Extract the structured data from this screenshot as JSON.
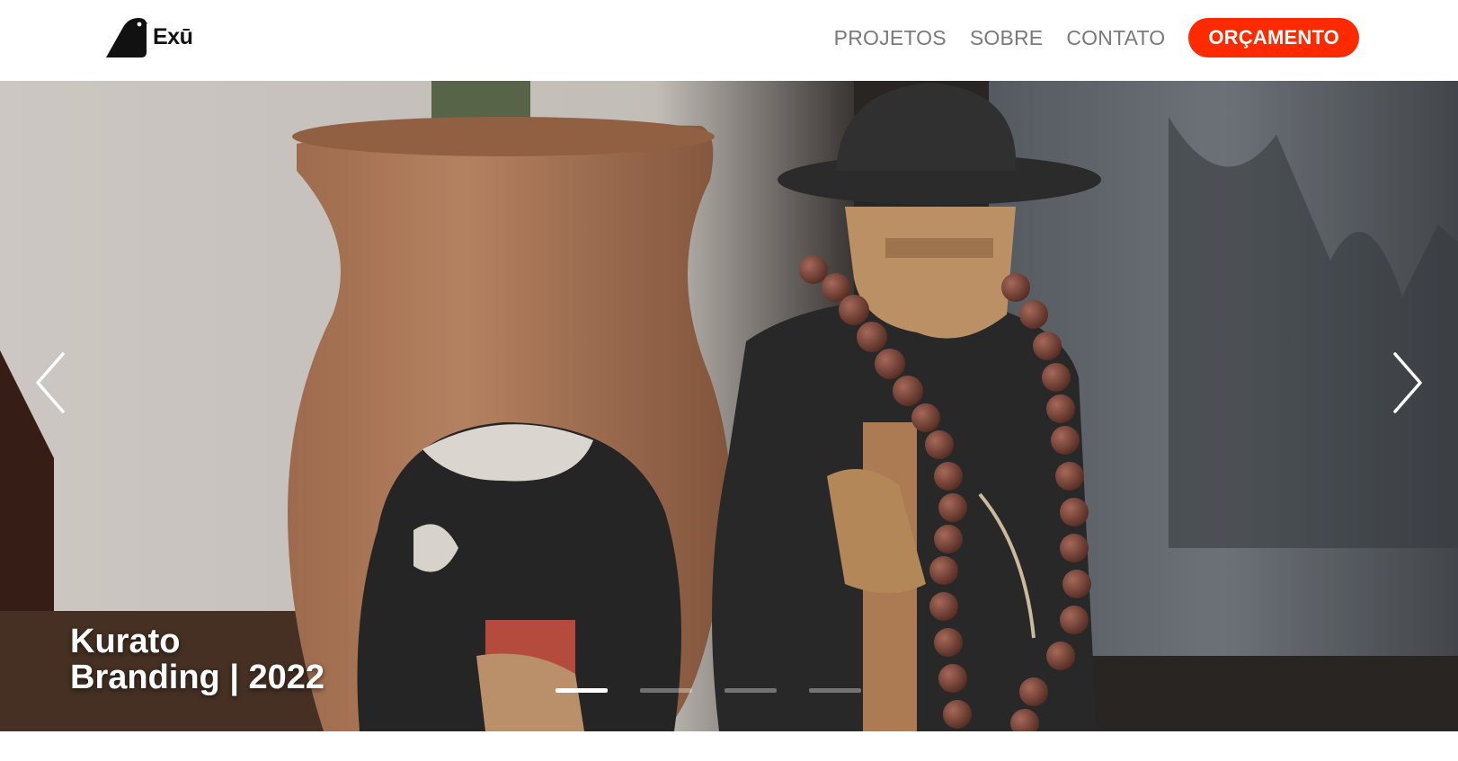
{
  "brand": {
    "name": "Exū",
    "logo_icon": "bird-icon"
  },
  "nav": {
    "links": [
      {
        "label": "PROJETOS"
      },
      {
        "label": "SOBRE"
      },
      {
        "label": "CONTATO"
      }
    ],
    "cta_label": "ORÇAMENTO"
  },
  "colors": {
    "accent": "#ff2a00",
    "nav_text": "#7a7a7a",
    "caption_text": "#ffffff"
  },
  "carousel": {
    "caption_line1": "Kurato",
    "caption_line2": "Branding | 2022",
    "prev_icon": "chevron-left-icon",
    "next_icon": "chevron-right-icon",
    "slide_count": 4,
    "active_index": 0
  }
}
